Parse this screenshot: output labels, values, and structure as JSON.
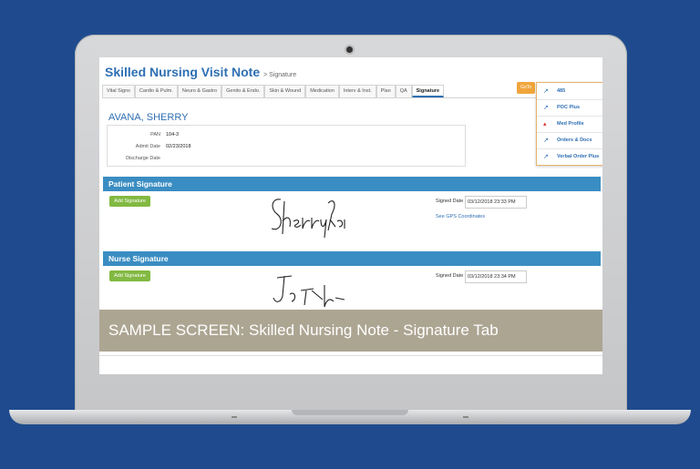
{
  "app": {
    "title": "Skilled Nursing Visit Note",
    "breadcrumb": "> Signature"
  },
  "tabs": [
    {
      "label": "Vital Signs"
    },
    {
      "label": "Cardio & Pulm."
    },
    {
      "label": "Neuro & Gastro"
    },
    {
      "label": "Genito & Endo."
    },
    {
      "label": "Skin & Wound"
    },
    {
      "label": "Medication"
    },
    {
      "label": "Interv & Inst."
    },
    {
      "label": "Plan"
    },
    {
      "label": "QA"
    },
    {
      "label": "Signature"
    }
  ],
  "goto": {
    "label": "GoTo",
    "items": [
      {
        "label": "485",
        "icon": "external-link-icon"
      },
      {
        "label": "POC Plus",
        "icon": "external-link-icon"
      },
      {
        "label": "Med Profile",
        "icon": "pin-icon"
      },
      {
        "label": "Orders & Docs",
        "icon": "external-link-icon"
      },
      {
        "label": "Verbal Order Plus",
        "icon": "external-link-icon"
      }
    ]
  },
  "patient": {
    "name": "AVANA, SHERRY",
    "fields": [
      {
        "label": "PAN",
        "value": "104-3"
      },
      {
        "label": "Admit Date",
        "value": "02/23/2018"
      },
      {
        "label": "Discharge Date",
        "value": ""
      }
    ]
  },
  "patient_signature": {
    "title": "Patient Signature",
    "add_label": "Add Signature",
    "signed_label": "Signed Date",
    "signed_value": "03/12/2018 23:33 PM",
    "gps_link": "See GPS Coordinates"
  },
  "nurse_signature": {
    "title": "Nurse Signature",
    "add_label": "Add Signature",
    "signed_label": "Signed Date",
    "signed_value": "03/12/2018 23:34 PM"
  },
  "overlay_caption": "SAMPLE SCREEN: Skilled Nursing Note - Signature Tab",
  "colors": {
    "background": "#1f4b8e",
    "accent": "#2e6fb3",
    "section_bar": "#3a8dc2",
    "button_green": "#82b942",
    "goto_orange": "#f0a53b"
  }
}
